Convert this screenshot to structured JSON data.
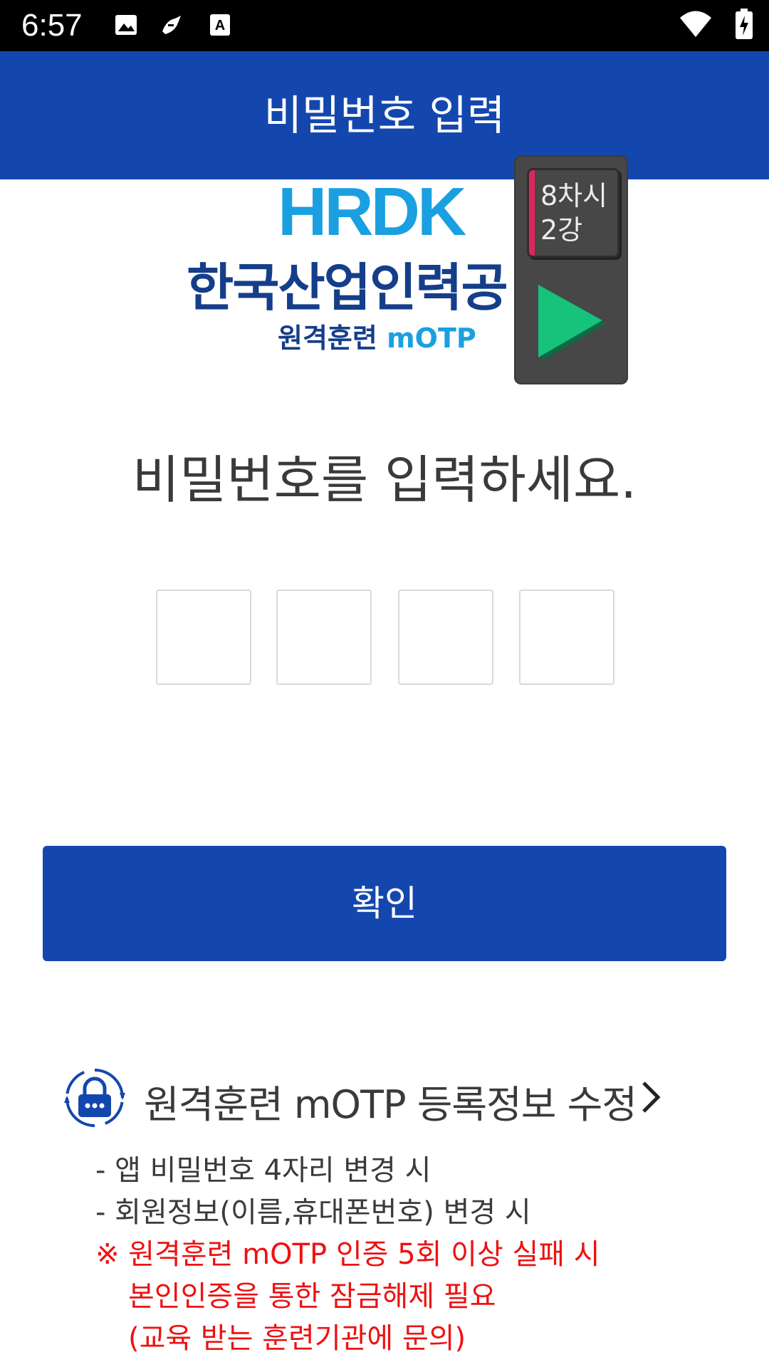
{
  "status_bar": {
    "time": "6:57"
  },
  "app_bar": {
    "title": "비밀번호 입력"
  },
  "logo": {
    "brand": "HRDK",
    "org_name": "한국산업인력공",
    "sub_korean": "원격훈련 ",
    "sub_english": "mOTP"
  },
  "widget": {
    "badge_text": "8차시\n2강"
  },
  "main": {
    "prompt": "비밀번호를 입력하세요.",
    "pin_length": 4,
    "confirm_label": "확인"
  },
  "edit_link": {
    "label": "원격훈련 mOTP 등록정보 수정"
  },
  "notes": {
    "line1": "- 앱 비밀번호 4자리 변경 시",
    "line2": "- 회원정보(이름,휴대폰번호) 변경 시",
    "warn1": "※ 원격훈련 mOTP 인증 5회 이상 실패 시",
    "warn2": "본인인증을 통한 잠금해제 필요",
    "warn3": "(교육 받는 훈련기관에 문의)"
  },
  "colors": {
    "primary": "#1447ae",
    "warning": "#ee1111",
    "widget_play": "#17c27a",
    "widget_accent": "#e0245e"
  }
}
